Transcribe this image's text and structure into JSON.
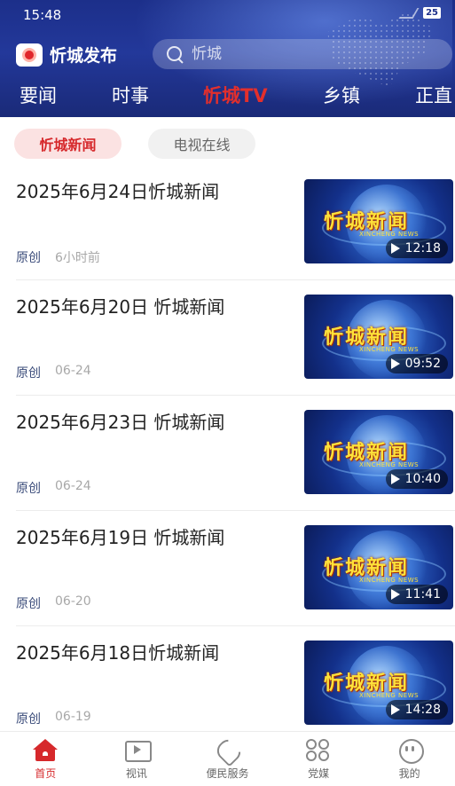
{
  "status_bar": {
    "time": "15:48",
    "battery": "25"
  },
  "header": {
    "app_name": "忻城发布",
    "search_placeholder": "忻城",
    "icons": {
      "logo": "app-logo-icon",
      "search": "search-icon"
    },
    "tabs": [
      {
        "label": "要闻",
        "active": false
      },
      {
        "label": "时事",
        "active": false
      },
      {
        "label": "忻城TV",
        "active": true
      },
      {
        "label": "乡镇",
        "active": false
      },
      {
        "label": "正直",
        "active": false
      }
    ],
    "accent_color": "#e32f2c",
    "bg_color": "#1f3290"
  },
  "sub_tabs": [
    {
      "label": "忻城新闻",
      "active": true
    },
    {
      "label": "电视在线",
      "active": false
    }
  ],
  "news": [
    {
      "title": "2025年6月24日忻城新闻",
      "source": "原创",
      "time": "6小时前",
      "thumb_title": "忻城新闻",
      "thumb_sub": "XINCHENG NEWS",
      "duration": "12:18"
    },
    {
      "title": "2025年6月20日 忻城新闻",
      "source": "原创",
      "time": "06-24",
      "thumb_title": "忻城新闻",
      "thumb_sub": "XINCHENG NEWS",
      "duration": "09:52"
    },
    {
      "title": "2025年6月23日 忻城新闻",
      "source": "原创",
      "time": "06-24",
      "thumb_title": "忻城新闻",
      "thumb_sub": "XINCHENG NEWS",
      "duration": "10:40"
    },
    {
      "title": "2025年6月19日  忻城新闻",
      "source": "原创",
      "time": "06-20",
      "thumb_title": "忻城新闻",
      "thumb_sub": "XINCHENG NEWS",
      "duration": "11:41"
    },
    {
      "title": "2025年6月18日忻城新闻",
      "source": "原创",
      "time": "06-19",
      "thumb_title": "忻城新闻",
      "thumb_sub": "XINCHENG NEWS",
      "duration": "14:28"
    }
  ],
  "bottom_nav": [
    {
      "label": "首页",
      "icon": "home-icon",
      "active": true
    },
    {
      "label": "视讯",
      "icon": "video-icon",
      "active": false
    },
    {
      "label": "便民服务",
      "icon": "service-heart-icon",
      "active": false
    },
    {
      "label": "党媒",
      "icon": "grid-icon",
      "active": false
    },
    {
      "label": "我的",
      "icon": "profile-smile-icon",
      "active": false
    }
  ]
}
